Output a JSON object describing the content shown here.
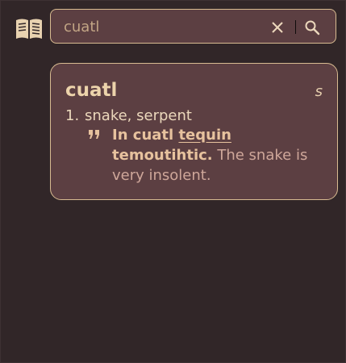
{
  "search": {
    "value": "cuatl",
    "placeholder": ""
  },
  "icons": {
    "dictionary": "open-book-icon",
    "clear": "close-icon",
    "search": "search-icon",
    "quote": "quote-icon"
  },
  "colors": {
    "background": "#312628",
    "panel": "#5c3f42",
    "border": "#d8bb91",
    "text": "#ecd8bc"
  },
  "entry": {
    "headword": "cuatl",
    "pos": "s",
    "senses": [
      {
        "number": "1.",
        "gloss": "snake, serpent",
        "example": {
          "source_before": "In cuatl ",
          "source_highlight": "tequin",
          "source_after": "temoutihtic.",
          "translation": " The snake is very insolent."
        }
      }
    ]
  }
}
